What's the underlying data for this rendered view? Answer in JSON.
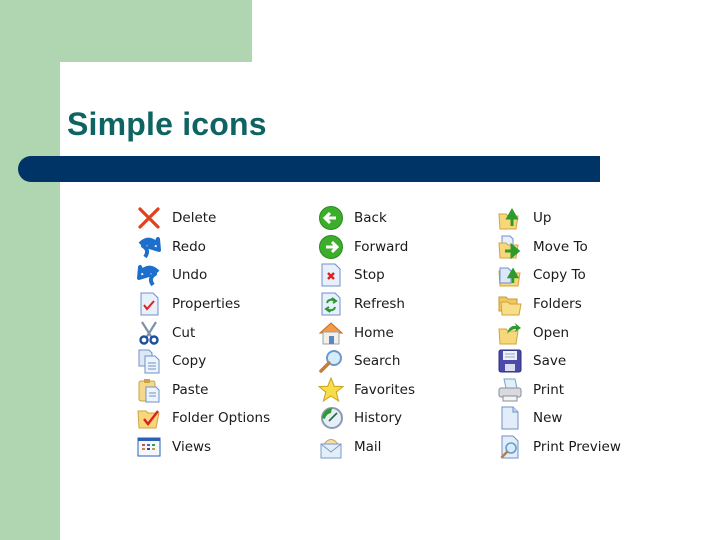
{
  "slide": {
    "title": "Simple icons",
    "colors": {
      "title": "#0e6463",
      "bar": "#003366",
      "accent_panel": "#b0d5b1"
    }
  },
  "columns": [
    {
      "items": [
        {
          "label": "Delete",
          "icon": "delete-icon"
        },
        {
          "label": "Redo",
          "icon": "redo-icon"
        },
        {
          "label": "Undo",
          "icon": "undo-icon"
        },
        {
          "label": "Properties",
          "icon": "properties-icon"
        },
        {
          "label": "Cut",
          "icon": "scissors-icon"
        },
        {
          "label": "Copy",
          "icon": "copy-icon"
        },
        {
          "label": "Paste",
          "icon": "paste-icon"
        },
        {
          "label": "Folder Options",
          "icon": "folder-options-icon"
        },
        {
          "label": "Views",
          "icon": "views-icon"
        }
      ]
    },
    {
      "items": [
        {
          "label": "Back",
          "icon": "back-arrow-icon"
        },
        {
          "label": "Forward",
          "icon": "forward-arrow-icon"
        },
        {
          "label": "Stop",
          "icon": "stop-icon"
        },
        {
          "label": "Refresh",
          "icon": "refresh-icon"
        },
        {
          "label": "Home",
          "icon": "home-icon"
        },
        {
          "label": "Search",
          "icon": "search-icon"
        },
        {
          "label": "Favorites",
          "icon": "star-icon"
        },
        {
          "label": "History",
          "icon": "history-icon"
        },
        {
          "label": "Mail",
          "icon": "mail-icon"
        }
      ]
    },
    {
      "items": [
        {
          "label": "Up",
          "icon": "folder-up-icon"
        },
        {
          "label": "Move To",
          "icon": "move-to-icon"
        },
        {
          "label": "Copy To",
          "icon": "copy-to-icon"
        },
        {
          "label": "Folders",
          "icon": "folders-icon"
        },
        {
          "label": "Open",
          "icon": "open-folder-icon"
        },
        {
          "label": "Save",
          "icon": "floppy-disk-icon"
        },
        {
          "label": "Print",
          "icon": "printer-icon"
        },
        {
          "label": "New",
          "icon": "new-document-icon"
        },
        {
          "label": "Print Preview",
          "icon": "print-preview-icon"
        }
      ]
    }
  ]
}
